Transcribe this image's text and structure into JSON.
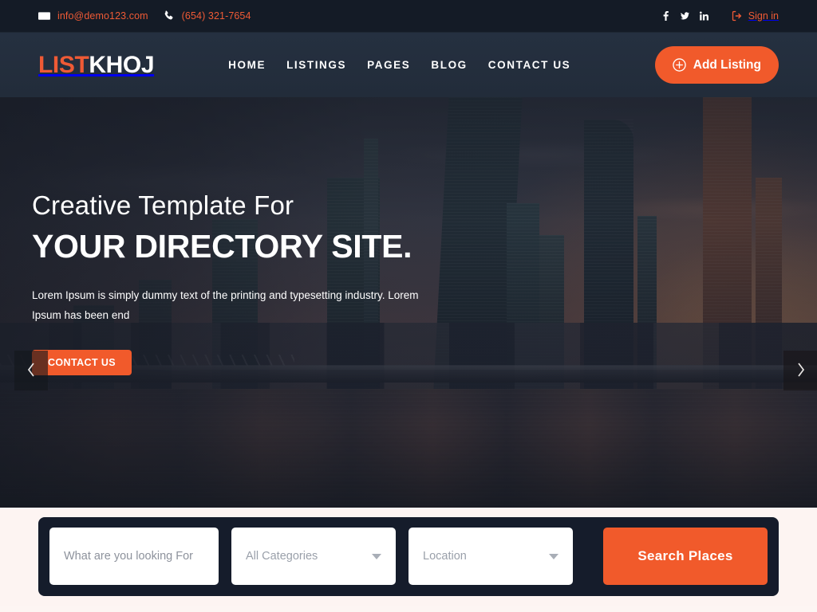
{
  "topbar": {
    "email": "info@demo123.com",
    "phone": "(654) 321-7654",
    "social": [
      {
        "name": "facebook-icon",
        "label": "f"
      },
      {
        "name": "twitter-icon",
        "label": "t"
      },
      {
        "name": "linkedin-icon",
        "label": "in"
      }
    ],
    "signin_label": "Sign in",
    "accent_color": "#ef5a35",
    "background_color": "#141b26"
  },
  "header": {
    "logo_first": "LIST",
    "logo_second": "KHOJ",
    "nav": [
      {
        "label": "HOME"
      },
      {
        "label": "LISTINGS"
      },
      {
        "label": "PAGES"
      },
      {
        "label": "BLOG"
      },
      {
        "label": "CONTACT US"
      }
    ],
    "add_listing_label": "Add Listing",
    "button_color": "#f15a2b",
    "background_color": "#232c3b"
  },
  "hero": {
    "subtitle": "Creative Template For",
    "title": "YOUR DIRECTORY SITE.",
    "description": "Lorem Ipsum is simply dummy text of the printing and typesetting industry. Lorem Ipsum has been end",
    "cta_label": "CONTACT US",
    "prev_label": "‹",
    "next_label": "›"
  },
  "search": {
    "keyword_placeholder": "What are you looking For",
    "keyword_value": "",
    "category_selected": "All Categories",
    "location_selected": "Location",
    "button_label": "Search Places",
    "panel_color": "#151c2b",
    "button_color": "#f15a2b",
    "section_background": "#fdf4f2"
  }
}
